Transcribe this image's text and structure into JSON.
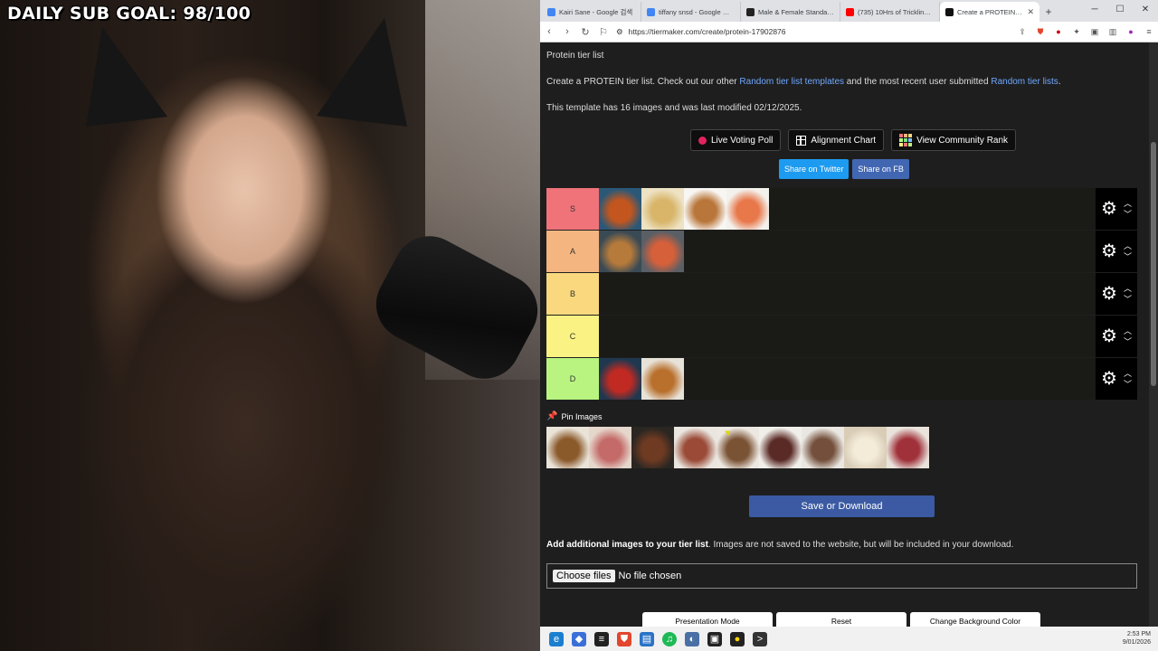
{
  "overlay": {
    "goal": "DAILY SUB GOAL: 98/100"
  },
  "browser": {
    "tabs": [
      {
        "label": "Kairi Sane - Google 검색",
        "color": "#4285f4"
      },
      {
        "label": "tiffany snsd - Google 검색",
        "color": "#4285f4"
      },
      {
        "label": "Male & Female Standards",
        "color": "#222222"
      },
      {
        "label": "(735) 10Hrs of Trickling Wa",
        "color": "#ff0000"
      },
      {
        "label": "Create a PROTEIN Tier",
        "color": "#111111",
        "active": true
      }
    ],
    "new_tab": "+",
    "url": "https://tiermaker.com/create/protein-17902876"
  },
  "page": {
    "breadcrumb": "Protein tier list",
    "intro_prefix": "Create a PROTEIN tier list. Check out our other ",
    "intro_link1": "Random tier list templates",
    "intro_mid": " and the most recent user submitted ",
    "intro_link2": "Random tier lists",
    "intro_suffix": ".",
    "template_info": "This template has 16 images and was last modified 02/12/2025.",
    "buttons": {
      "live_voting": "Live Voting Poll",
      "alignment": "Alignment Chart",
      "community": "View Community Rank"
    },
    "share": {
      "twitter": "Share on Twitter",
      "fb": "Share on FB"
    },
    "tiers": [
      {
        "label": "S",
        "color": "#f0737a",
        "items": [
          "crab",
          "fish-fries",
          "egg",
          "salmon"
        ]
      },
      {
        "label": "A",
        "color": "#f5b580",
        "items": [
          "roast-chicken",
          "shrimp"
        ]
      },
      {
        "label": "B",
        "color": "#fad87e",
        "items": []
      },
      {
        "label": "C",
        "color": "#faf282",
        "items": []
      },
      {
        "label": "D",
        "color": "#b9f481",
        "items": [
          "lobster",
          "roast-turkey"
        ]
      }
    ],
    "pin_label": "Pin Images",
    "pool": [
      "beans",
      "ham",
      "ribs",
      "sausage",
      "meatballs",
      "steak",
      "burger-patties",
      "tofu",
      "raw-beef"
    ],
    "save": "Save or Download",
    "add_title": "Add additional images to your tier list",
    "add_desc": ". Images are not saved to the website, but will be included in your download.",
    "choose": "Choose files",
    "no_file": "No file chosen",
    "bottom": {
      "presentation": "Presentation Mode",
      "reset": "Reset",
      "bg": "Change Background Color"
    }
  },
  "taskbar": {
    "time": "2:53 PM",
    "date": "9/01/2026"
  },
  "food_colors": {
    "crab": [
      "#2b5877",
      "#c2561e"
    ],
    "fish-fries": [
      "#ede2c3",
      "#d8b569"
    ],
    "egg": [
      "#f8f6f2",
      "#b9763a"
    ],
    "salmon": [
      "#f3f1ec",
      "#e8774a"
    ],
    "roast-chicken": [
      "#3a4a55",
      "#b67a3a"
    ],
    "shrimp": [
      "#5a5f66",
      "#d6603a"
    ],
    "lobster": [
      "#20384f",
      "#c02a22"
    ],
    "roast-turkey": [
      "#e7e2d8",
      "#b9702c"
    ],
    "beans": [
      "#e9e3d8",
      "#8b5a2b"
    ],
    "ham": [
      "#e5d7cc",
      "#c46a68"
    ],
    "ribs": [
      "#2a2622",
      "#6e3a22"
    ],
    "sausage": [
      "#e9e5df",
      "#9a4a36"
    ],
    "meatballs": [
      "#ece7e0",
      "#7a5234"
    ],
    "steak": [
      "#f1efea",
      "#5a2a26"
    ],
    "burger-patties": [
      "#eae7e2",
      "#74503c"
    ],
    "tofu": [
      "#d9cdb8",
      "#f4ecd9"
    ],
    "raw-beef": [
      "#e9e3dc",
      "#a0313a"
    ]
  }
}
